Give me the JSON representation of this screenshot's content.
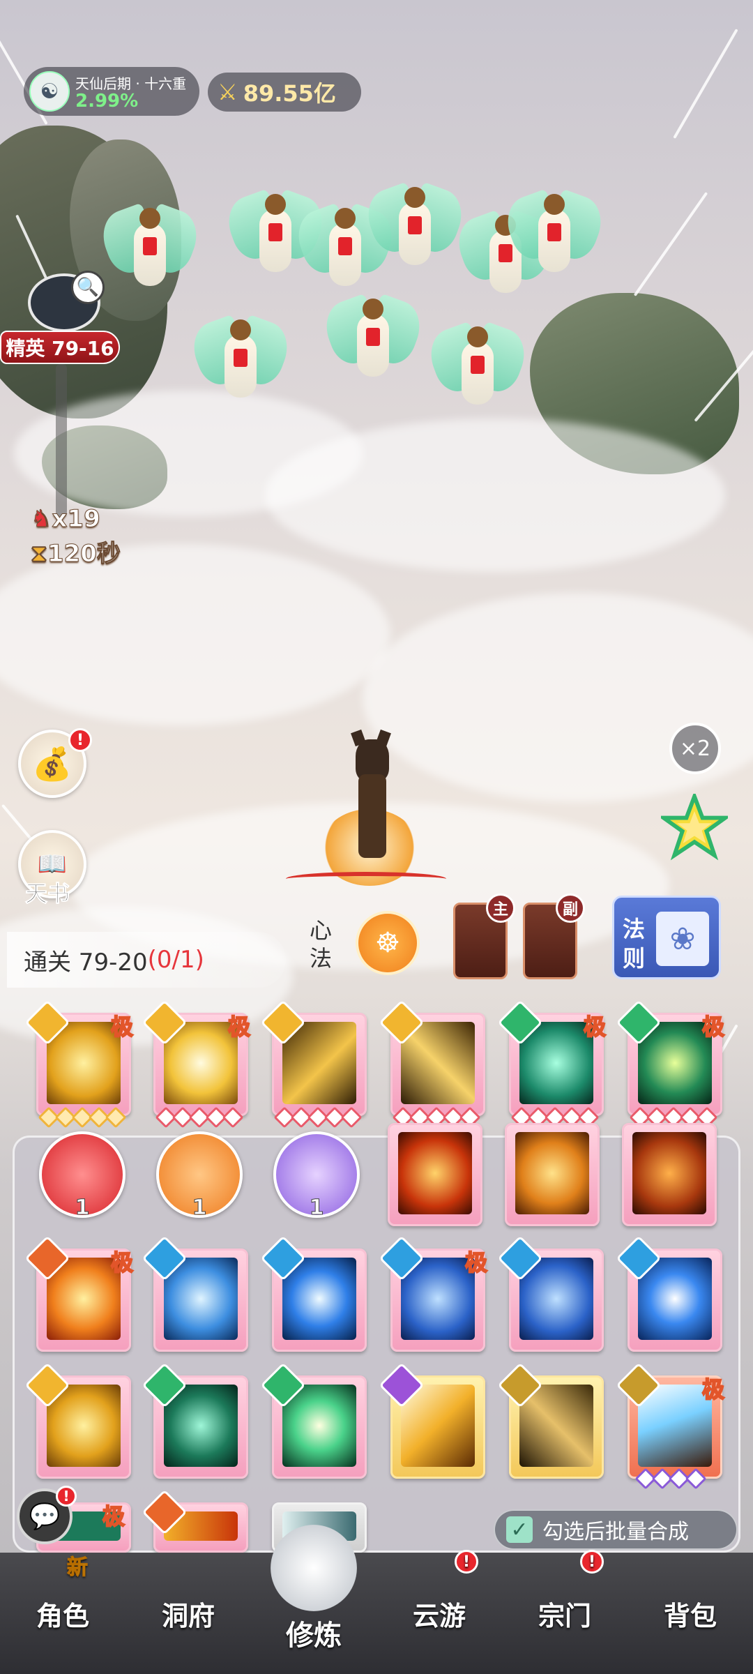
{
  "hud": {
    "realm_title": "天仙后期 · 十六重",
    "realm_percent": "2.99%",
    "power_value": "89.55亿"
  },
  "stage": {
    "badge": "精英 79-16",
    "enemy_count": "x19",
    "timer": "120秒"
  },
  "left_buttons": {
    "bag_alert": "!",
    "tianshu_label": "天书"
  },
  "right_buttons": {
    "speed_label": "×2",
    "faze_label_1": "法",
    "faze_label_2": "则"
  },
  "progress": {
    "label": "通关 79-20",
    "counter": "(0/1)"
  },
  "xinfa_label": "心法",
  "weapons": {
    "main_tag": "主",
    "sub_tag": "副"
  },
  "grade_tag": "极",
  "orbs": [
    {
      "count": "1",
      "color": "#e2343a"
    },
    {
      "count": "1",
      "color": "#f08a28"
    },
    {
      "count": "1",
      "color": "#9a6be0"
    }
  ],
  "batch_merge": {
    "label": "勾选后批量合成",
    "checked": true
  },
  "chat_alert": "!",
  "nav": {
    "items": [
      {
        "label": "角色",
        "badge": "新"
      },
      {
        "label": "洞府",
        "badge": ""
      },
      {
        "label": "修炼",
        "badge": ""
      },
      {
        "label": "云游",
        "badge": "!"
      },
      {
        "label": "宗门",
        "badge": "!"
      },
      {
        "label": "背包",
        "badge": ""
      }
    ]
  }
}
